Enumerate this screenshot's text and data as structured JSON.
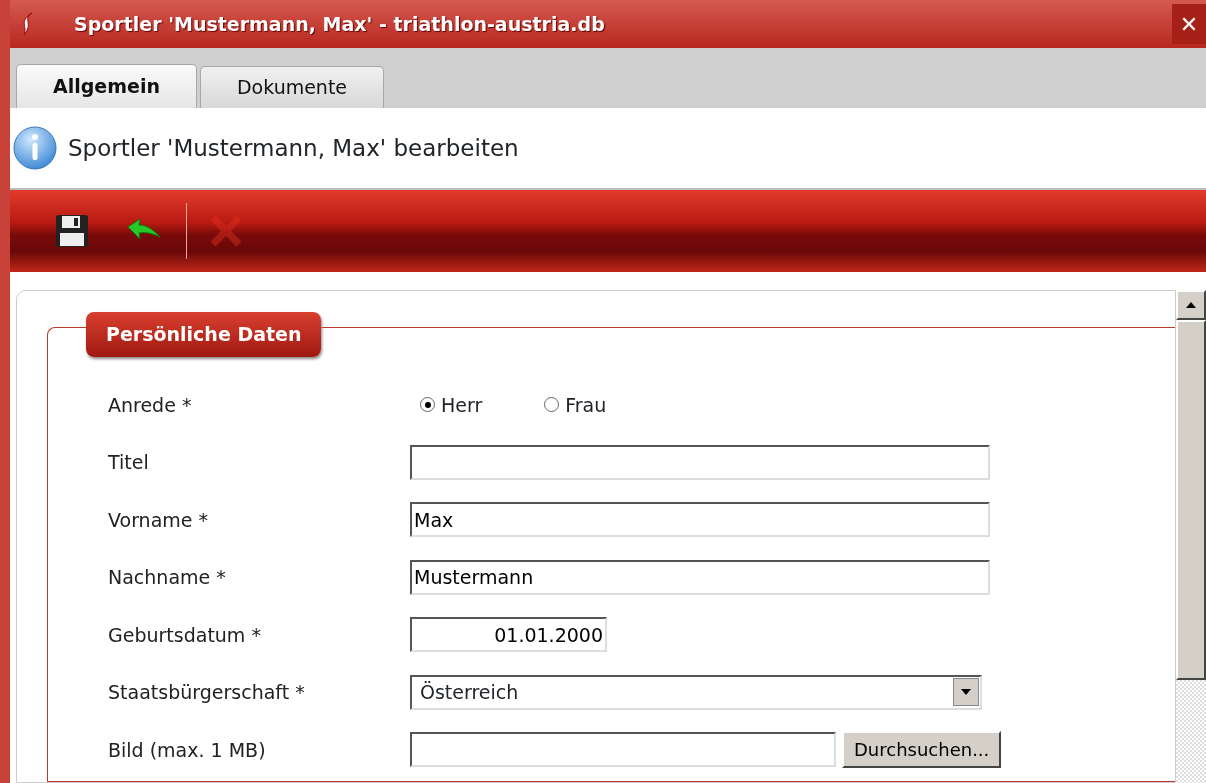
{
  "window": {
    "title": "Sportler 'Mustermann, Max' - triathlon-austria.db",
    "close": "✕"
  },
  "tabs": [
    {
      "label": "Allgemein",
      "selected": true
    },
    {
      "label": "Dokumente",
      "selected": false
    }
  ],
  "header": {
    "title": "Sportler 'Mustermann, Max' bearbeiten"
  },
  "toolbar": [
    {
      "kind": "save",
      "disabled": false
    },
    {
      "kind": "undo",
      "disabled": false
    },
    {
      "kind": "separator"
    },
    {
      "kind": "delete",
      "disabled": true
    }
  ],
  "section": {
    "title": "Persönliche Daten"
  },
  "fields": [
    {
      "kind": "radio",
      "label": "Anrede *",
      "options": [
        {
          "label": "Herr",
          "selected": true
        },
        {
          "label": "Frau",
          "selected": false
        }
      ]
    },
    {
      "kind": "text",
      "label": "Titel"
    },
    {
      "kind": "text",
      "label": "Vorname *",
      "value": "Max"
    },
    {
      "kind": "text",
      "label": "Nachname *",
      "value": "Mustermann"
    },
    {
      "kind": "date",
      "label": "Geburtsdatum *",
      "value": "01.01.2000"
    },
    {
      "kind": "select",
      "label": "Staatsbürgerschaft *",
      "value": "Österreich"
    },
    {
      "kind": "file",
      "label": "Bild (max. 1 MB)",
      "button": "Durchsuchen..."
    }
  ]
}
